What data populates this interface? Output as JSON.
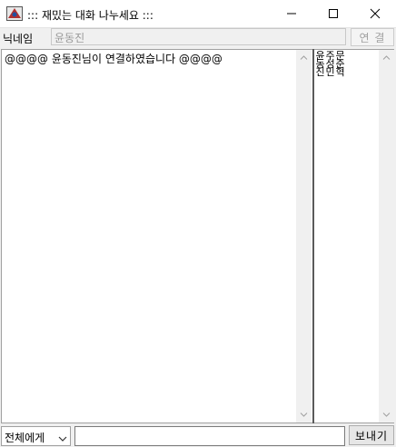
{
  "window": {
    "title": "::: 재밌는 대화 나누세요 :::",
    "icons": {
      "app": "app-icon",
      "minimize": "minimize-icon",
      "maximize": "maximize-icon",
      "close": "close-icon"
    }
  },
  "nickname": {
    "label": "닉네임",
    "value": "윤동진"
  },
  "connect_button": "연 결",
  "chat": {
    "messages": [
      "@@@@ 윤동진님이 연결하였습니다 @@@@"
    ]
  },
  "users": [
    "윤동진",
    "주성민",
    "문준혁"
  ],
  "bottom": {
    "target_selected": "전체에게",
    "message_value": "",
    "send_label": "보내기"
  },
  "colors": {
    "title_bg": "#ffffff",
    "window_bg": "#f0f0f0",
    "disabled_text": "#a0a0a0"
  }
}
